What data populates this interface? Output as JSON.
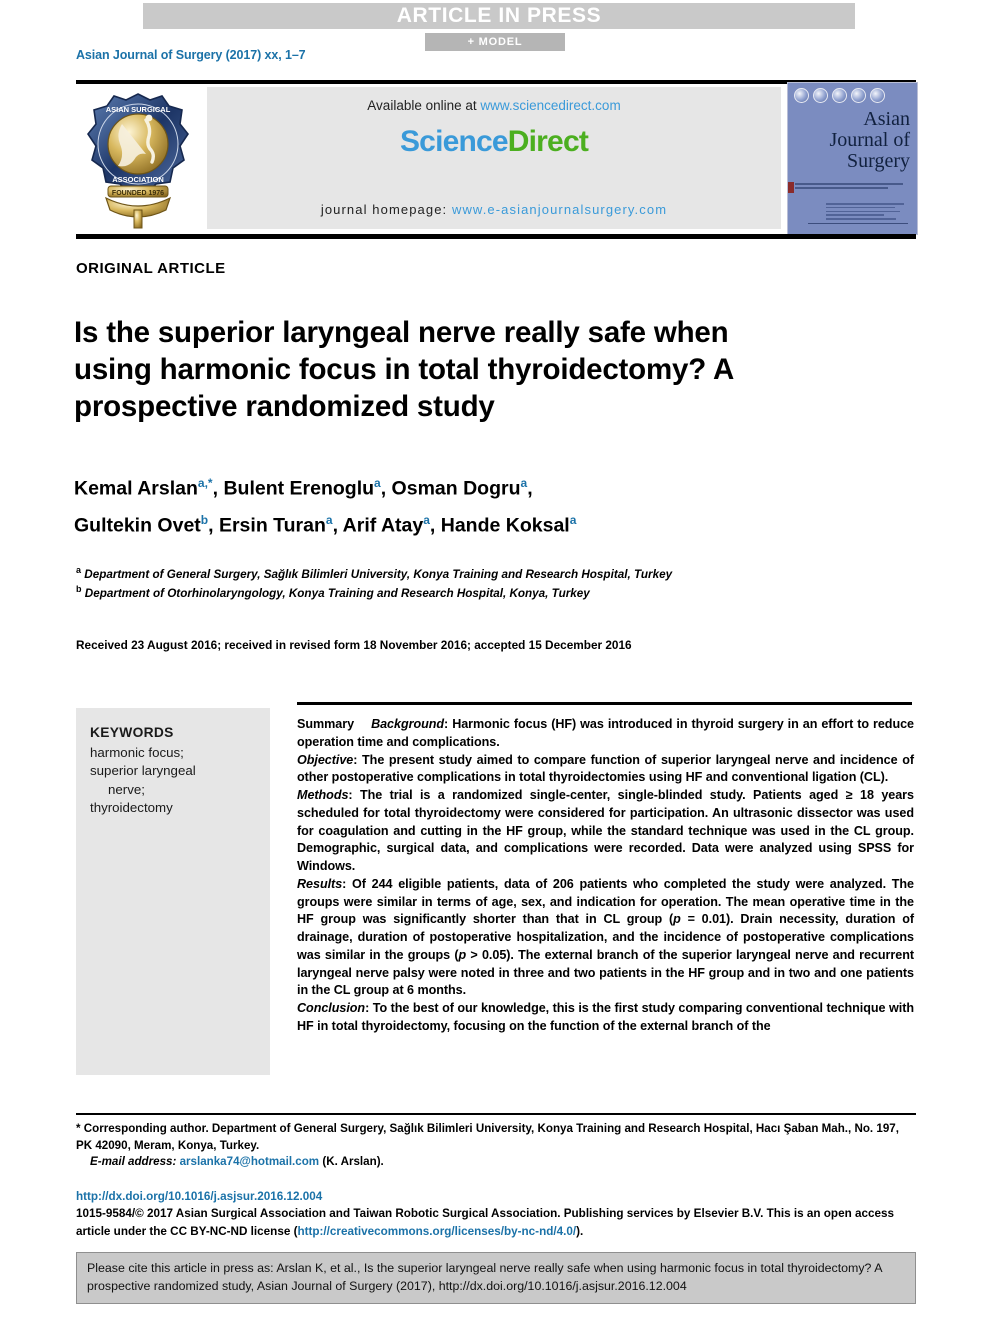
{
  "banner": {
    "article_in_press": "ARTICLE IN PRESS",
    "model": "+ MODEL"
  },
  "running_head": "Asian Journal of Surgery (2017) xx, 1–7",
  "masthead": {
    "available_online_prefix": "Available online at ",
    "sciencedirect_url": "www.sciencedirect.com",
    "logo_science": "Science",
    "logo_direct": "Direct",
    "homepage_label": "journal homepage: ",
    "homepage_url": "www.e-asianjournalsurgery.com",
    "society_logo_alt": "Asian Surgical Association seal, founded 1976",
    "cover_title_line1": "Asian",
    "cover_title_line2": "Journal of",
    "cover_title_line3": "Surgery"
  },
  "article": {
    "kicker": "ORIGINAL ARTICLE",
    "title": "Is the superior laryngeal nerve really safe when using harmonic focus in total thyroidectomy? A prospective randomized study",
    "authors_line1": "Kemal Arslan",
    "authors_line1_sup": "a,*",
    "authors_line1_b": ", Bulent Erenoglu",
    "authors_line1_b_sup": "a",
    "authors_line1_c": ", Osman Dogru",
    "authors_line1_c_sup": "a",
    "authors_line1_tail": ",",
    "authors_line2": "Gultekin Ovet",
    "authors_line2_sup": "b",
    "authors_line2_b": ", Ersin Turan",
    "authors_line2_b_sup": "a",
    "authors_line2_c": ", Arif Atay",
    "authors_line2_c_sup": "a",
    "authors_line2_d": ", Hande Koksal",
    "authors_line2_d_sup": "a",
    "affiliation_a_sup": "a",
    "affiliation_a": " Department of General Surgery, Sağlık Bilimleri University, Konya Training and Research Hospital, Turkey",
    "affiliation_b_sup": "b",
    "affiliation_b": " Department of Otorhinolaryngology, Konya Training and Research Hospital, Konya, Turkey",
    "received": "Received 23 August 2016; received in revised form 18 November 2016; accepted 15 December 2016"
  },
  "keywords": {
    "heading": "KEYWORDS",
    "items": [
      "harmonic focus;",
      "superior laryngeal",
      "nerve;",
      "thyroidectomy"
    ]
  },
  "abstract": {
    "summary_label": "Summary",
    "background_label": "Background",
    "background_text": ": Harmonic focus (HF) was introduced in thyroid surgery in an effort to reduce operation time and complications.",
    "objective_label": "Objective",
    "objective_text": ": The present study aimed to compare function of superior laryngeal nerve and incidence of other postoperative complications in total thyroidectomies using HF and conventional ligation (CL).",
    "methods_label": "Methods",
    "methods_text": ": The trial is a randomized single-center, single-blinded study. Patients aged ≥ 18 years scheduled for total thyroidectomy were considered for participation. An ultrasonic dissector was used for coagulation and cutting in the HF group, while the standard technique was used in the CL group. Demographic, surgical data, and complications were recorded. Data were analyzed using SPSS for Windows.",
    "results_label": "Results",
    "results_text_1": ": Of 244 eligible patients, data of 206 patients who completed the study were analyzed. The groups were similar in terms of age, sex, and indication for operation. The mean operative time in the HF group was significantly shorter than that in CL group (",
    "results_p1": "p",
    "results_text_2": " = 0.01). Drain necessity, duration of drainage, duration of postoperative hospitalization, and the incidence of postoperative complications was similar in the groups (",
    "results_p2": "p",
    "results_text_3": " > 0.05). The external branch of the superior laryngeal nerve and recurrent laryngeal nerve palsy were noted in three and two patients in the HF group and in two and one patients in the CL group at 6 months.",
    "conclusion_label": "Conclusion",
    "conclusion_text": ": To the best of our knowledge, this is the first study comparing conventional technique with HF in total thyroidectomy, focusing on the function of the external branch of the"
  },
  "footnote": {
    "corresponding": "* Corresponding author. Department of General Surgery, Sağlık Bilimleri University, Konya Training and Research Hospital, Hacı Şaban Mah., No. 197, PK 42090, Meram, Konya, Turkey.",
    "email_label": "E-mail address:",
    "email": "arslanka74@hotmail.com",
    "email_owner": "(K. Arslan)."
  },
  "publisher": {
    "doi_url": "http://dx.doi.org/10.1016/j.asjsur.2016.12.004",
    "copyright_1": "1015-9584/© 2017 Asian Surgical Association and Taiwan Robotic Surgical Association. Publishing services by Elsevier B.V. This is an open access article under the CC BY-NC-ND license (",
    "license_url": "http://creativecommons.org/licenses/by-nc-nd/4.0/",
    "copyright_2": ")."
  },
  "citation_box": {
    "text": "Please cite this article in press as: Arslan K, et al., Is the superior laryngeal nerve really safe when using harmonic focus in total thyroidectomy? A prospective randomized study, Asian Journal of Surgery (2017), http://dx.doi.org/10.1016/j.asjsur.2016.12.004"
  },
  "colors": {
    "link_blue": "#1b72a8",
    "sciencedirect_blue": "#3a9ad9",
    "sciencedirect_green": "#4caf20",
    "band_gray": "#c9c9c9",
    "panel_gray": "#e6e6e6",
    "cover_blue": "#7b8cc0"
  }
}
